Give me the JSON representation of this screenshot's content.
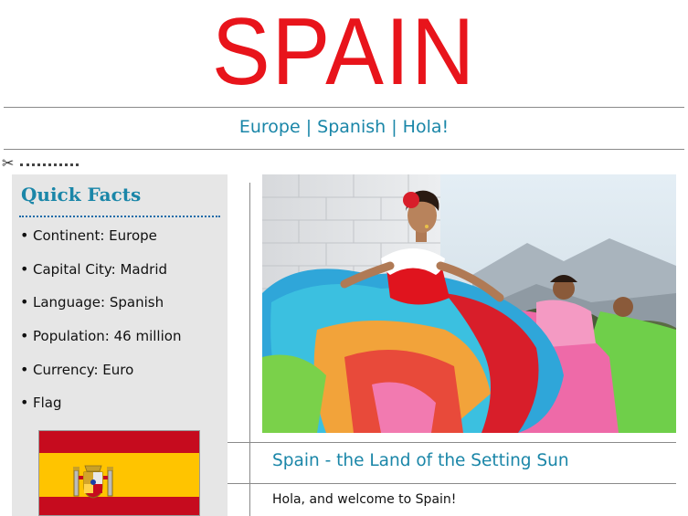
{
  "header": {
    "title": "SPAIN",
    "subtitle": "Europe | Spanish | Hola!"
  },
  "icons": {
    "scissors": "scissors-icon"
  },
  "quick_facts": {
    "title": "Quick Facts",
    "items": [
      "Continent: Europe",
      "Capital City: Madrid",
      "Language: Spanish",
      "Population: 46 million",
      "Currency: Euro",
      "Flag"
    ]
  },
  "article": {
    "heading": "Spain - the Land of the Setting Sun",
    "intro": "Hola, and welcome to Spain!"
  },
  "colors": {
    "title_red": "#e8141b",
    "accent_teal": "#1a86a8",
    "sidebar_bg": "#e6e6e6",
    "flag_red": "#c60b1e",
    "flag_yellow": "#ffc400"
  }
}
